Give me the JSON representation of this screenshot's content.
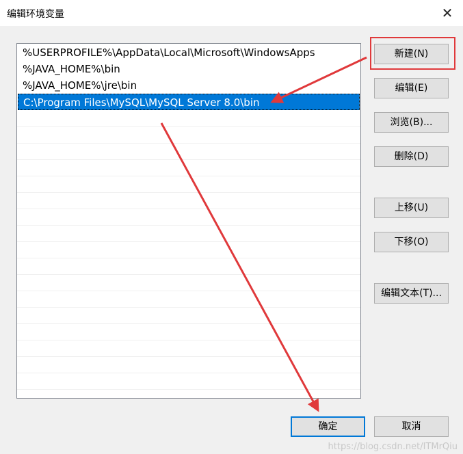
{
  "window": {
    "title": "编辑环境变量",
    "close_glyph": "✕"
  },
  "list": {
    "items": [
      "%USERPROFILE%\\AppData\\Local\\Microsoft\\WindowsApps",
      "%JAVA_HOME%\\bin",
      "%JAVA_HOME%\\jre\\bin",
      "C:\\Program Files\\MySQL\\MySQL Server 8.0\\bin"
    ],
    "selected_index": 3
  },
  "buttons": {
    "new": "新建(N)",
    "edit": "编辑(E)",
    "browse": "浏览(B)...",
    "delete": "删除(D)",
    "move_up": "上移(U)",
    "move_down": "下移(O)",
    "edit_text": "编辑文本(T)...",
    "ok": "确定",
    "cancel": "取消"
  },
  "annotations": {
    "highlight_color": "#e0393b"
  },
  "watermark": "https://blog.csdn.net/ITMrQiu"
}
